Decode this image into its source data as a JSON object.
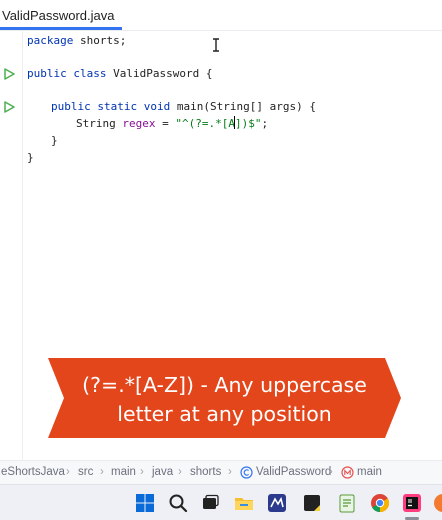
{
  "tab": {
    "label": "ValidPassword.java"
  },
  "code": {
    "line1": {
      "kw": "package",
      "rest": " shorts;"
    },
    "line2": {
      "kw1": "public",
      "kw2": "class",
      "rest": " ValidPassword {"
    },
    "line3": {
      "kw1": "public",
      "kw2": "static",
      "kw3": "void",
      "rest": " main(String[] args) {"
    },
    "line4": {
      "type": "String",
      "var": "regex",
      "eq": " = ",
      "str_a": "\"^(?=.*[A",
      "str_b": "])$\"",
      "semi": ";"
    },
    "line5": {
      "text": "}"
    },
    "line6": {
      "text": "}"
    }
  },
  "banner": {
    "line1": "(?=.*[A-Z]) - Any uppercase",
    "line2": "letter at any position",
    "color": "#e4461c"
  },
  "breadcrumb": {
    "project": "eShortsJava",
    "items": [
      "src",
      "main",
      "java",
      "shorts"
    ],
    "class_name": "ValidPassword",
    "method": "main"
  },
  "taskbar": {
    "icons": [
      "windows-start-icon",
      "search-icon",
      "task-view-icon",
      "file-explorer-icon",
      "app-icon",
      "sticky-notes-icon",
      "notepad-icon",
      "chrome-icon",
      "intellij-icon",
      "other-app-icon"
    ]
  }
}
